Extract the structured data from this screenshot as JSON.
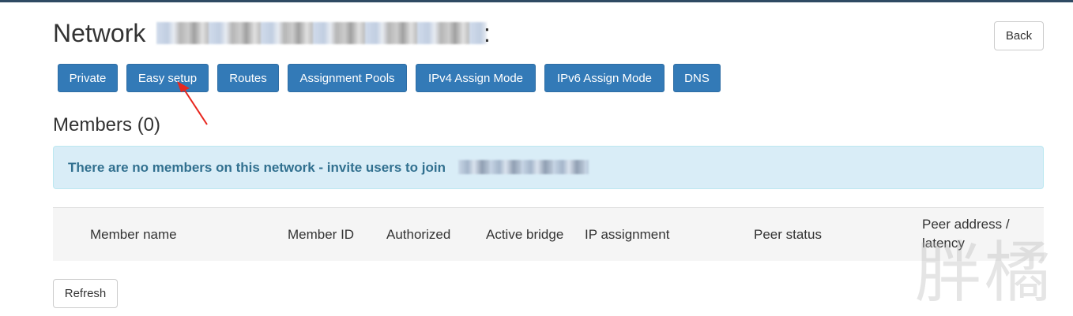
{
  "header": {
    "title": "Network",
    "title_suffix": ":",
    "back_label": "Back"
  },
  "tabs": [
    {
      "label": "Private"
    },
    {
      "label": "Easy setup"
    },
    {
      "label": "Routes"
    },
    {
      "label": "Assignment Pools"
    },
    {
      "label": "IPv4 Assign Mode"
    },
    {
      "label": "IPv6 Assign Mode"
    },
    {
      "label": "DNS"
    }
  ],
  "members": {
    "heading": "Members (0)",
    "empty_message": "There are no members on this network - invite users to join"
  },
  "table": {
    "columns": [
      "Member name",
      "Member ID",
      "Authorized",
      "Active bridge",
      "IP assignment",
      "Peer status",
      "Peer address / latency"
    ]
  },
  "refresh_label": "Refresh",
  "watermark": "胖橘",
  "colors": {
    "primary": "#337ab7",
    "alert_bg": "#d9edf7",
    "alert_text": "#31708f",
    "annotation_arrow": "#e8271f"
  }
}
